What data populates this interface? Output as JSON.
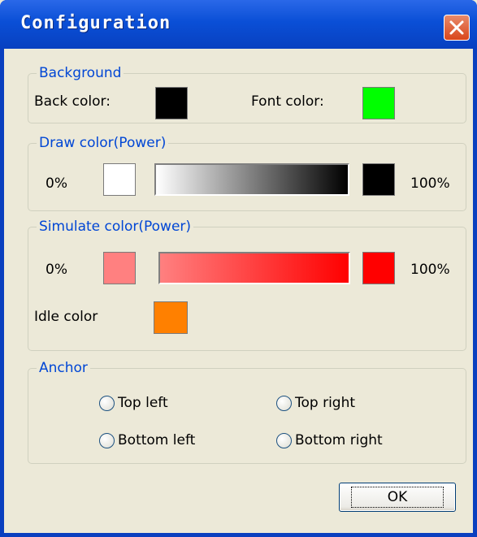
{
  "window": {
    "title": "Configuration"
  },
  "background_group": {
    "legend": "Background",
    "back_color_label": "Back color:",
    "back_color": "#000000",
    "font_color_label": "Font color:",
    "font_color": "#00ff00"
  },
  "draw_group": {
    "legend": "Draw color(Power)",
    "min_label": "0%",
    "max_label": "100%",
    "min_color": "#ffffff",
    "max_color": "#000000"
  },
  "simulate_group": {
    "legend": "Simulate color(Power)",
    "min_label": "0%",
    "max_label": "100%",
    "min_color": "#ff8080",
    "max_color": "#ff0000",
    "idle_label": "Idle color",
    "idle_color": "#ff8000"
  },
  "anchor_group": {
    "legend": "Anchor",
    "options": [
      "Top left",
      "Top right",
      "Bottom left",
      "Bottom right"
    ]
  },
  "buttons": {
    "ok": "OK"
  }
}
